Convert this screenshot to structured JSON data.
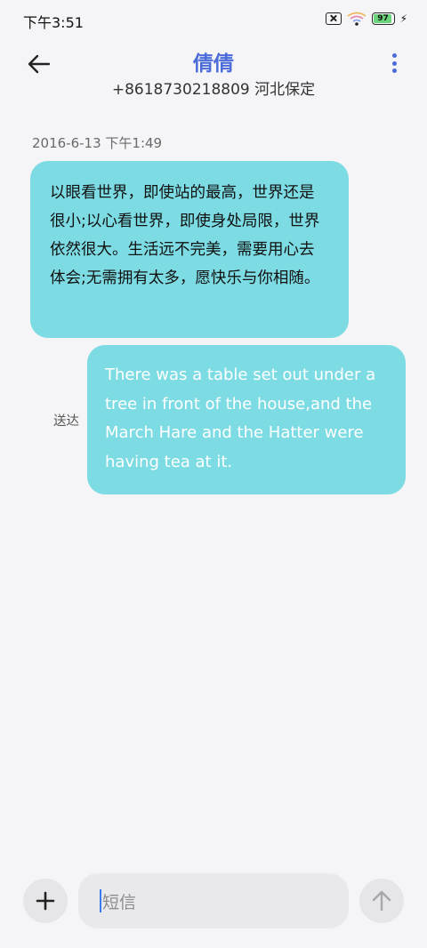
{
  "status_bar": {
    "time": "下午3:51",
    "battery_level": "97",
    "battery_fraction": 0.97,
    "icons": [
      "sim-off-icon",
      "wifi-icon",
      "battery-icon",
      "charging-bolt-icon"
    ]
  },
  "header": {
    "contact_name": "倩倩",
    "contact_subtitle": "+8618730218809 河北保定",
    "back_icon": "back-arrow-icon",
    "more_icon": "more-vertical-icon"
  },
  "conversation": {
    "timestamp": "2016-6-13 下午1:49",
    "incoming_message": "以眼看世界，即使站的最高，世界还是很小;以心看世界，即使身处局限，世界依然很大。生活远不完美，需要用心去体会;无需拥有太多，愿快乐与你相随。",
    "outgoing_message": "There was a table set out under a tree in front of the house,and the March Hare and the Hatter were having tea at it.",
    "outgoing_status": "送达"
  },
  "composer": {
    "input_placeholder": "短信",
    "add_icon": "plus-icon",
    "send_icon": "send-arrow-icon"
  },
  "colors": {
    "accent": "#4a6bd8",
    "bubble": "#7cdbe3",
    "background": "#f5f5f7",
    "battery_fill": "#6ad47a"
  }
}
